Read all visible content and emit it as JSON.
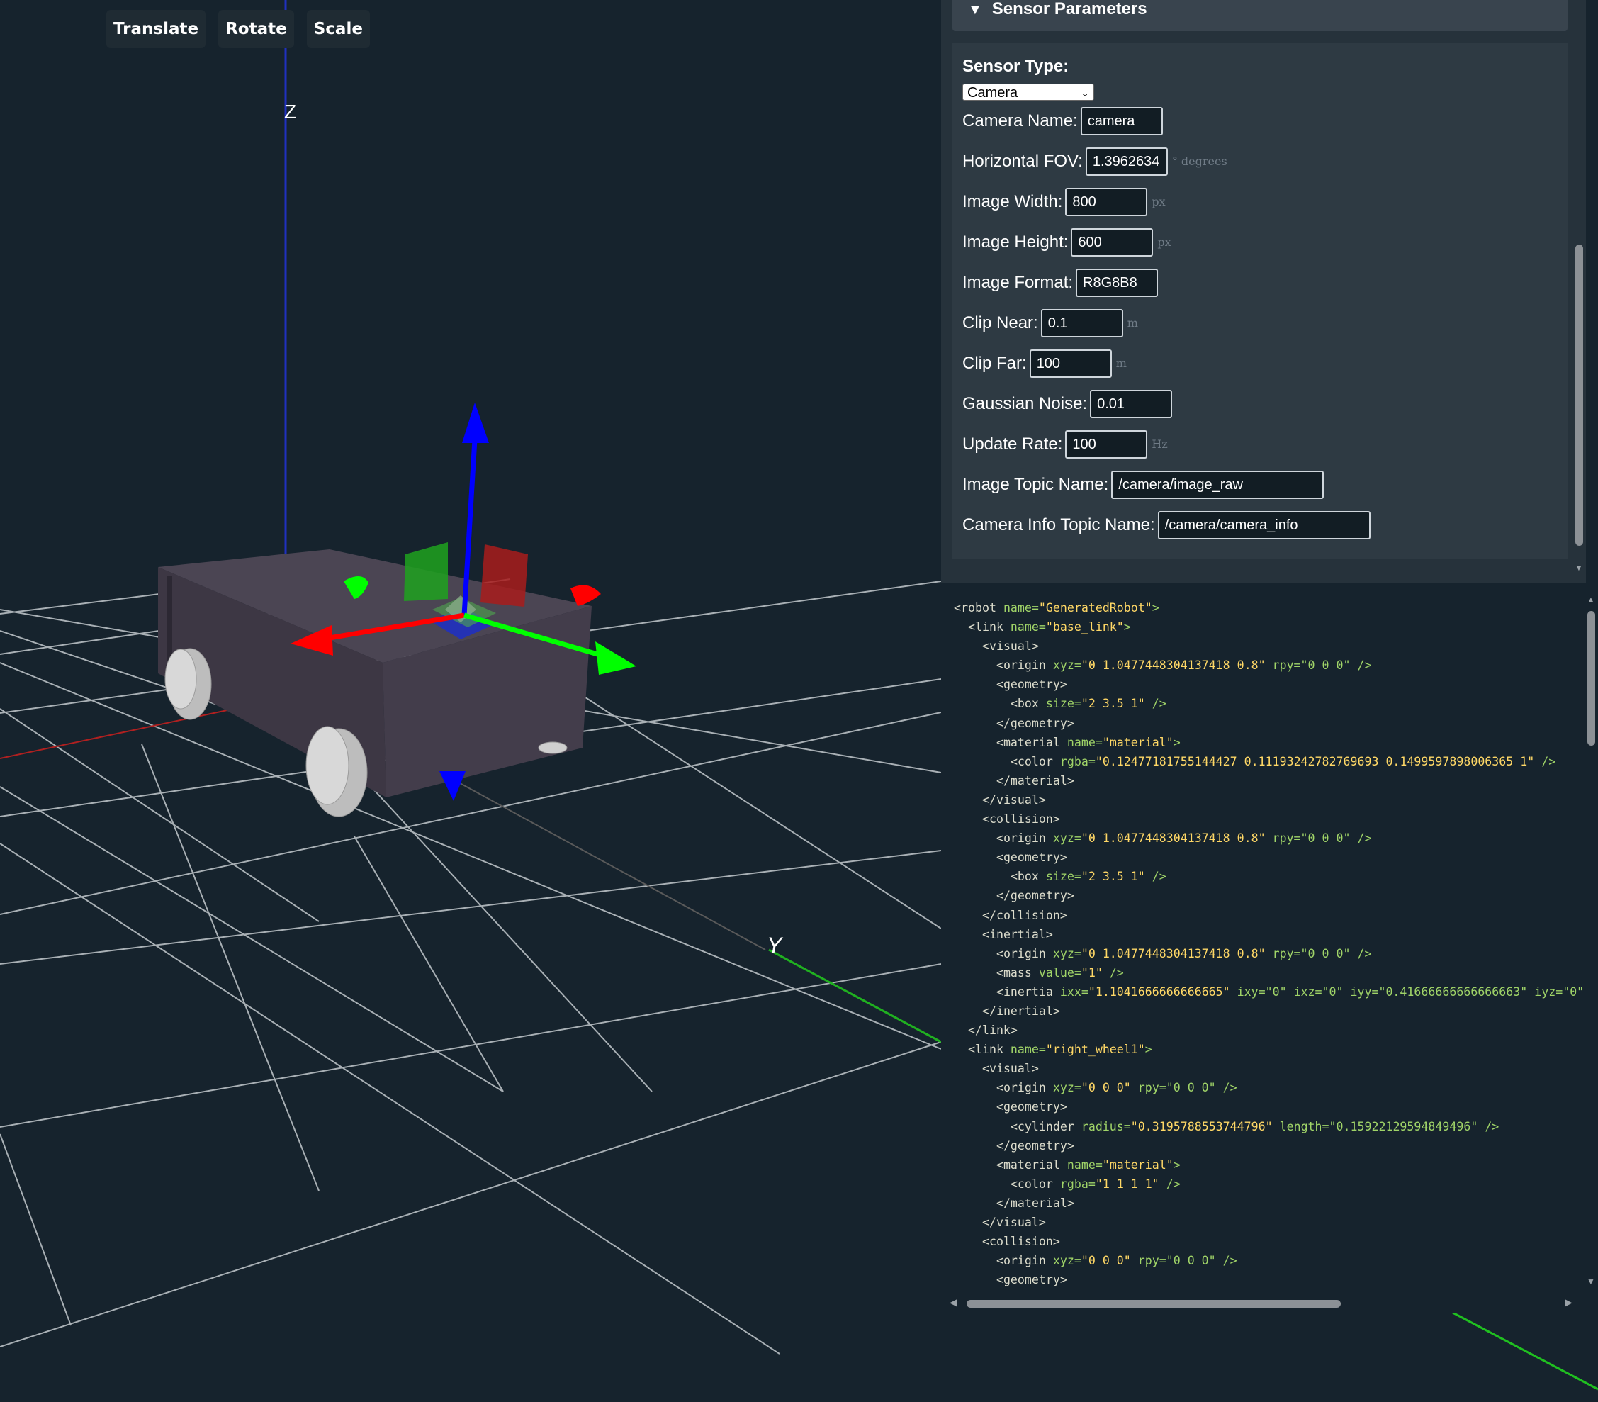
{
  "toolbar": {
    "translate": "Translate",
    "rotate": "Rotate",
    "scale": "Scale"
  },
  "axes": {
    "z_label": "Z",
    "y_label": "Y"
  },
  "colors": {
    "background": "#16232d",
    "robot_body": "#403a48",
    "wheel": "#c8c8c8",
    "x_axis": "#ff0000",
    "y_axis": "#00e000",
    "z_axis": "#0000ff"
  },
  "sensor_panel": {
    "title": "Sensor Parameters",
    "sensor_type_label": "Sensor Type:",
    "sensor_type_value": "Camera",
    "fields": [
      {
        "label": "Camera Name:",
        "value": "camera",
        "unit": ""
      },
      {
        "label": "Horizontal FOV:",
        "value": "1.3962634",
        "unit": "° degrees"
      },
      {
        "label": "Image Width:",
        "value": "800",
        "unit": "px"
      },
      {
        "label": "Image Height:",
        "value": "600",
        "unit": "px"
      },
      {
        "label": "Image Format:",
        "value": "R8G8B8",
        "unit": ""
      },
      {
        "label": "Clip Near:",
        "value": "0.1",
        "unit": "m"
      },
      {
        "label": "Clip Far:",
        "value": "100",
        "unit": "m"
      },
      {
        "label": "Gaussian Noise:",
        "value": "0.01",
        "unit": ""
      },
      {
        "label": "Update Rate:",
        "value": "100",
        "unit": "Hz"
      },
      {
        "label": "Image Topic Name:",
        "value": "/camera/image_raw",
        "unit": ""
      },
      {
        "label": "Camera Info Topic Name:",
        "value": "/camera/camera_info",
        "unit": ""
      }
    ]
  },
  "urdf_lines": [
    [
      0,
      "<robot",
      " name=",
      "\"GeneratedRobot\"",
      ">"
    ],
    [
      1,
      "<link",
      " name=",
      "\"base_link\"",
      ">"
    ],
    [
      2,
      "<visual>",
      "",
      "",
      ""
    ],
    [
      3,
      "<origin",
      " xyz=",
      "\"0 1.0477448304137418 0.8\"",
      " rpy=\"0 0 0\" />"
    ],
    [
      3,
      "<geometry>",
      "",
      "",
      ""
    ],
    [
      4,
      "<box",
      " size=",
      "\"2 3.5 1\"",
      " />"
    ],
    [
      3,
      "</geometry>",
      "",
      "",
      ""
    ],
    [
      3,
      "<material",
      " name=",
      "\"material\"",
      ">"
    ],
    [
      4,
      "<color",
      " rgba=",
      "\"0.12477181755144427 0.11193242782769693 0.1499597898006365 1\"",
      " />"
    ],
    [
      3,
      "</material>",
      "",
      "",
      ""
    ],
    [
      2,
      "</visual>",
      "",
      "",
      ""
    ],
    [
      2,
      "<collision>",
      "",
      "",
      ""
    ],
    [
      3,
      "<origin",
      " xyz=",
      "\"0 1.0477448304137418 0.8\"",
      " rpy=\"0 0 0\" />"
    ],
    [
      3,
      "<geometry>",
      "",
      "",
      ""
    ],
    [
      4,
      "<box",
      " size=",
      "\"2 3.5 1\"",
      " />"
    ],
    [
      3,
      "</geometry>",
      "",
      "",
      ""
    ],
    [
      2,
      "</collision>",
      "",
      "",
      ""
    ],
    [
      2,
      "<inertial>",
      "",
      "",
      ""
    ],
    [
      3,
      "<origin",
      " xyz=",
      "\"0 1.0477448304137418 0.8\"",
      " rpy=\"0 0 0\" />"
    ],
    [
      3,
      "<mass",
      " value=",
      "\"1\"",
      " />"
    ],
    [
      3,
      "<inertia",
      " ixx=",
      "\"1.1041666666666665\"",
      " ixy=\"0\" ixz=\"0\" iyy=\"0.41666666666666663\" iyz=\"0\""
    ],
    [
      2,
      "</inertial>",
      "",
      "",
      ""
    ],
    [
      1,
      "</link>",
      "",
      "",
      ""
    ],
    [
      1,
      "<link",
      " name=",
      "\"right_wheel1\"",
      ">"
    ],
    [
      2,
      "<visual>",
      "",
      "",
      ""
    ],
    [
      3,
      "<origin",
      " xyz=",
      "\"0 0 0\"",
      " rpy=\"0 0 0\" />"
    ],
    [
      3,
      "<geometry>",
      "",
      "",
      ""
    ],
    [
      4,
      "<cylinder",
      " radius=",
      "\"0.3195788553744796\"",
      " length=\"0.15922129594849496\" />"
    ],
    [
      3,
      "</geometry>",
      "",
      "",
      ""
    ],
    [
      3,
      "<material",
      " name=",
      "\"material\"",
      ">"
    ],
    [
      4,
      "<color",
      " rgba=",
      "\"1 1 1 1\"",
      " />"
    ],
    [
      3,
      "</material>",
      "",
      "",
      ""
    ],
    [
      2,
      "</visual>",
      "",
      "",
      ""
    ],
    [
      2,
      "<collision>",
      "",
      "",
      ""
    ],
    [
      3,
      "<origin",
      " xyz=",
      "\"0 0 0\"",
      " rpy=\"0 0 0\" />"
    ],
    [
      3,
      "<geometry>",
      "",
      "",
      ""
    ]
  ]
}
